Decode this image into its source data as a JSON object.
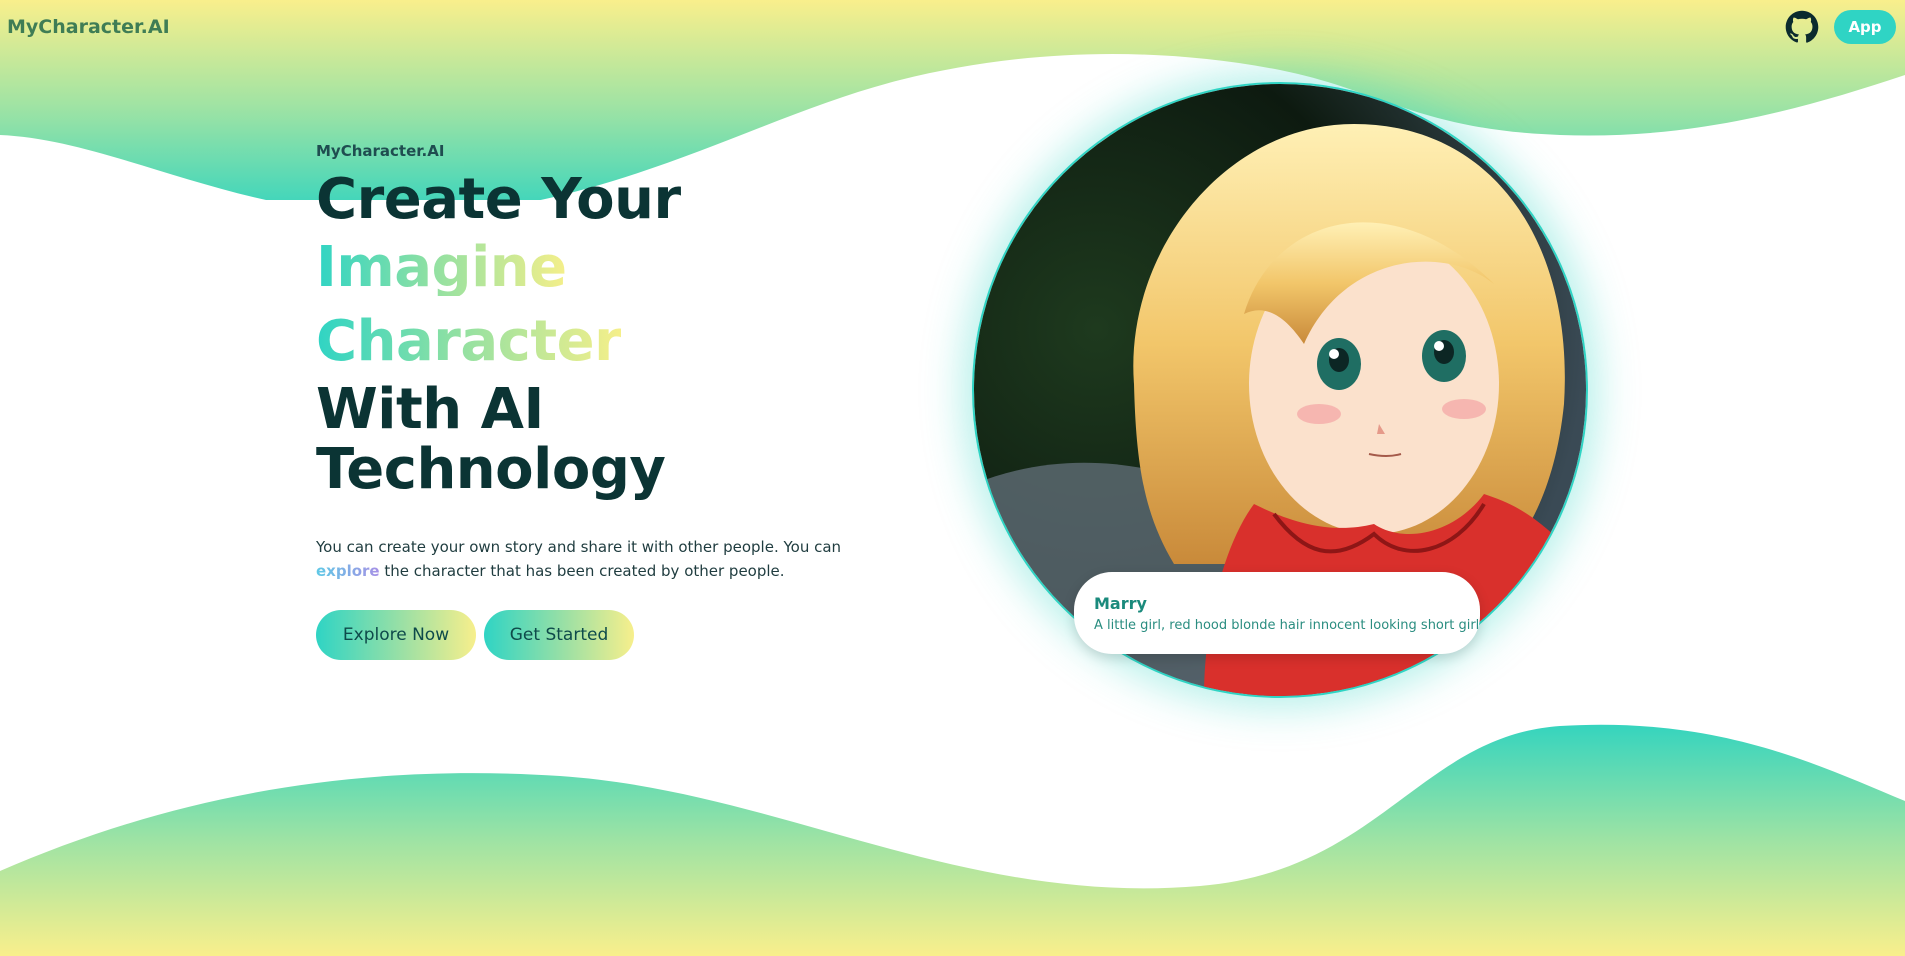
{
  "brand": "MyCharacter.AI",
  "nav": {
    "app_label": "App",
    "github_icon": "github-icon"
  },
  "hero": {
    "eyebrow": "MyCharacter.AI",
    "line1": "Create Your",
    "line2": "Imagine",
    "line3": "Character",
    "line4": "With AI",
    "line5": "Technology",
    "desc_before": "You can create your own story and share it with other people. You can",
    "desc_link": "explore",
    "desc_after": " the character that has been created by other people.",
    "explore_button": "Explore Now",
    "start_button": "Get Started"
  },
  "character": {
    "name": "Marry",
    "description": "A little girl, red hood blonde hair innocent looking short girl"
  },
  "colors": {
    "accent": "#2fd4c4",
    "gradient_mid": "#8ee0a3",
    "gradient_end": "#f5ef8a",
    "heading": "#0b3434"
  }
}
